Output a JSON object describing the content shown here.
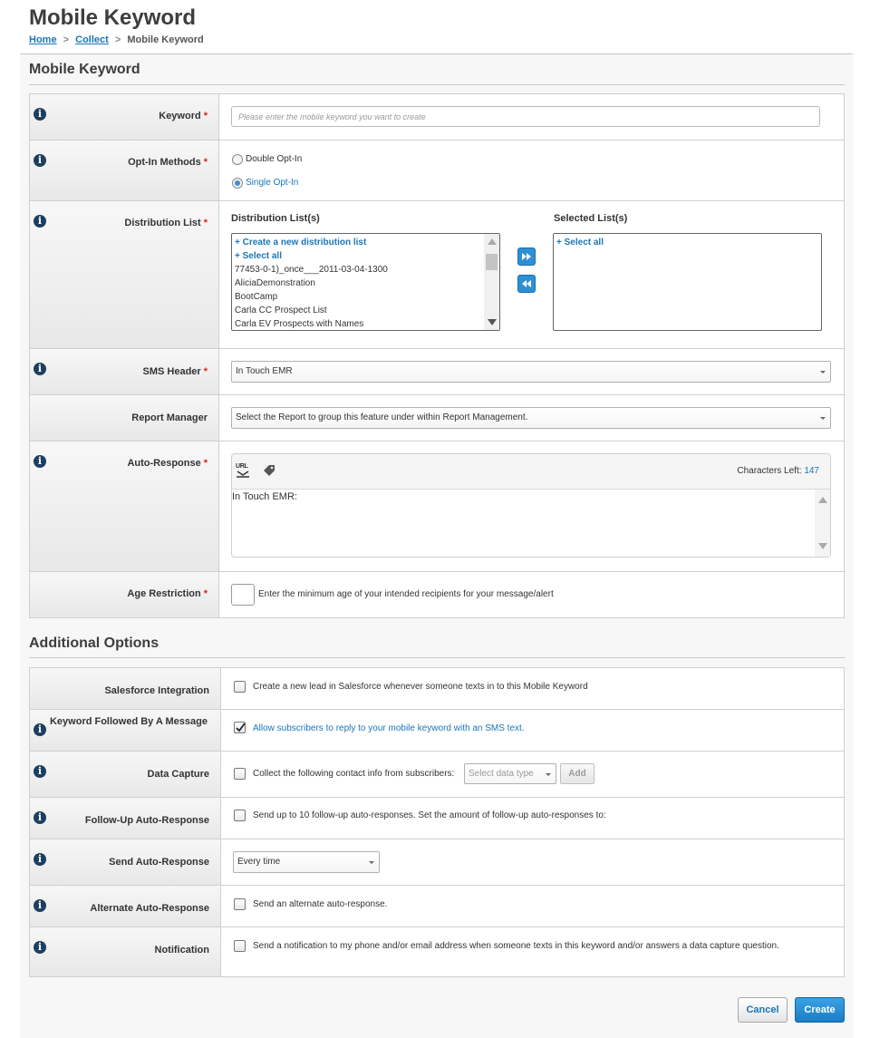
{
  "page": {
    "title": "Mobile Keyword",
    "breadcrumb": {
      "home": "Home",
      "collect": "Collect",
      "current": "Mobile Keyword",
      "sep": ">"
    }
  },
  "main_section": {
    "title": "Mobile Keyword",
    "keyword": {
      "label": "Keyword",
      "placeholder": "Please enter the mobile keyword you want to create",
      "value": ""
    },
    "opt_in": {
      "label": "Opt-In Methods",
      "options": [
        "Double Opt-In",
        "Single Opt-In"
      ],
      "selected": "Single Opt-In"
    },
    "distribution": {
      "label": "Distribution List",
      "available_header": "Distribution List(s)",
      "selected_header": "Selected List(s)",
      "available_items": [
        "+ Create a new distribution list",
        "+ Select all",
        "77453-0-1)_once___2011-03-04-1300",
        "AliciaDemonstration",
        "BootCamp",
        "Carla CC Prospect List",
        "Carla EV Prospects with Names"
      ],
      "selected_items": [
        "+ Select all"
      ]
    },
    "sms_header": {
      "label": "SMS Header",
      "value": "In Touch EMR"
    },
    "report_manager": {
      "label": "Report Manager",
      "value": "Select the Report to group this feature under within Report Management."
    },
    "auto_response": {
      "label": "Auto-Response",
      "chars_left_label": "Characters Left:",
      "chars_left_value": "147",
      "text": "In Touch EMR:",
      "url_icon_text": "URL"
    },
    "age_restriction": {
      "label": "Age Restriction",
      "value": "",
      "help": "Enter the minimum age of your intended recipients for your message/alert"
    },
    "required_mark": "*"
  },
  "additional": {
    "title": "Additional Options",
    "salesforce": {
      "label": "Salesforce Integration",
      "text": "Create a new lead in Salesforce whenever someone texts in to this Mobile Keyword",
      "checked": false
    },
    "followed_by_message": {
      "label": "Keyword Followed By A Message",
      "text": "Allow subscribers to reply to your mobile keyword with an SMS text.",
      "checked": true
    },
    "data_capture": {
      "label": "Data Capture",
      "text": "Collect the following contact info from subscribers:",
      "select": "Select data type",
      "add_button": "Add",
      "checked": false
    },
    "followup": {
      "label": "Follow-Up Auto-Response",
      "text": "Send up to 10 follow-up auto-responses. Set the amount of follow-up auto-responses to:",
      "checked": false
    },
    "send_auto_response": {
      "label": "Send Auto-Response",
      "value": "Every time"
    },
    "alternate": {
      "label": "Alternate Auto-Response",
      "text": "Send an alternate auto-response.",
      "checked": false
    },
    "notification": {
      "label": "Notification",
      "text": "Send a notification to my phone and/or email address when someone texts in this keyword and/or answers a data capture question.",
      "checked": false
    }
  },
  "actions": {
    "cancel": "Cancel",
    "create": "Create"
  },
  "info_icon_glyph": "i",
  "colors": {
    "link": "#1a76b8",
    "required": "#d8261b",
    "primary_button": "#1b7cc4",
    "info_icon": "#1c3f60"
  }
}
